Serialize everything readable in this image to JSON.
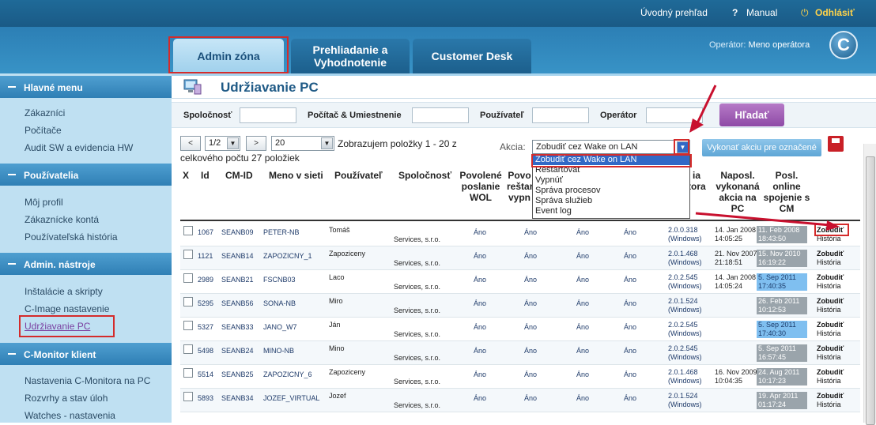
{
  "topbar": {
    "overview": "Úvodný prehľad",
    "manual": "Manual",
    "logout": "Odhlásiť"
  },
  "tabs": [
    {
      "label": "Admin zóna"
    },
    {
      "label": "Prehliadanie a Vyhodnotenie"
    },
    {
      "label": "Customer Desk"
    }
  ],
  "operator": {
    "label": "Operátor:",
    "name": "Meno operátora"
  },
  "logo": "C",
  "sidebar": {
    "sections": [
      {
        "title": "Hlavné menu",
        "items": [
          "Zákazníci",
          "Počítače",
          "Audit SW a evidencia HW"
        ]
      },
      {
        "title": "Používatelia",
        "items": [
          "Môj profil",
          "Zákaznícke kontá",
          "Používateľská história"
        ]
      },
      {
        "title": "Admin. nástroje",
        "items": [
          "Inštalácie a skripty",
          "C-Image nastavenie",
          "Udržiavanie PC"
        ]
      },
      {
        "title": "C-Monitor klient",
        "items": [
          "Nastavenia C-Monitora na PC",
          "Rozvrhy a stav úloh",
          "Watches - nastavenia"
        ]
      }
    ]
  },
  "page": {
    "title": "Udržiavanie PC"
  },
  "filters": {
    "company": "Spoločnosť",
    "computer": "Počítač & Umiestnenie",
    "user": "Používateľ",
    "operator": "Operátor",
    "search_button": "Hľadať"
  },
  "pagination": {
    "prev": "<",
    "page": "1/2",
    "next": ">",
    "per_page": "20",
    "info": "Zobrazujem položky 1 - 20 z",
    "info2": "celkového počtu 27 položiek"
  },
  "action": {
    "label": "Akcia:",
    "selected": "Zobudiť cez Wake on LAN",
    "options": [
      "Zobudiť cez Wake on LAN",
      "Reštartovať",
      "Vypnúť",
      "Správa procesov",
      "Správa služieb",
      "Event log"
    ],
    "execute_button": "Vykonať akciu pre označené"
  },
  "table": {
    "headers": {
      "x": "X",
      "id": "Id",
      "cmid": "CM-ID",
      "name": "Meno v sieti",
      "user": "Používateľ",
      "company": "Spoločnosť",
      "wol": "Povolené poslanie WOL",
      "restart": "Povo reštar vypn",
      "version": "ia tora",
      "lastaction": "Naposl. vykonaná akcia na PC",
      "online": "Posl. online spojenie s CM"
    },
    "rows": [
      {
        "id": "1067",
        "cmid": "SEANB09",
        "name": "PETER-NB",
        "user": "Tomáš",
        "company": "Services, s.r.o.",
        "wol": "Áno",
        "c2": "Áno",
        "c3": "Áno",
        "c4": "Áno",
        "ver": "2.0.0.318",
        "os": "(Windows)",
        "last": "14. Jan 2008",
        "lastt": "14:05:25",
        "on1": "11. Feb 2008",
        "on2": "18:43:50",
        "onstyle": "gray",
        "action": "Zobudiť",
        "hist": "História"
      },
      {
        "id": "1121",
        "cmid": "SEANB14",
        "name": "ZAPOZICNY_1",
        "user": "Zapoziceny",
        "company": "Services, s.r.o.",
        "wol": "Áno",
        "c2": "Áno",
        "c3": "Áno",
        "c4": "Áno",
        "ver": "2.0.1.468",
        "os": "(Windows)",
        "last": "21. Nov 2007",
        "lastt": "21:18:51",
        "on1": "15. Nov 2010",
        "on2": "16:19:22",
        "onstyle": "gray",
        "action": "Zobudiť",
        "hist": "História"
      },
      {
        "id": "2989",
        "cmid": "SEANB21",
        "name": "FSCNB03",
        "user": "Laco",
        "company": "Services, s.r.o.",
        "wol": "Áno",
        "c2": "Áno",
        "c3": "Áno",
        "c4": "Áno",
        "ver": "2.0.2.545",
        "os": "(Windows)",
        "last": "14. Jan 2008",
        "lastt": "14:05:24",
        "on1": "5. Sep 2011",
        "on2": "17:40:35",
        "onstyle": "blue",
        "action": "Zobudiť",
        "hist": "História"
      },
      {
        "id": "5295",
        "cmid": "SEANB56",
        "name": "SONA-NB",
        "user": "Miro",
        "company": "Services, s.r.o.",
        "wol": "Áno",
        "c2": "Áno",
        "c3": "Áno",
        "c4": "Áno",
        "ver": "2.0.1.524",
        "os": "(Windows)",
        "last": "",
        "lastt": "",
        "on1": "26. Feb 2011",
        "on2": "10:12:53",
        "onstyle": "gray",
        "action": "Zobudiť",
        "hist": "História"
      },
      {
        "id": "5327",
        "cmid": "SEANB33",
        "name": "JANO_W7",
        "user": "Ján",
        "company": "Services, s.r.o.",
        "wol": "Áno",
        "c2": "Áno",
        "c3": "Áno",
        "c4": "Áno",
        "ver": "2.0.2.545",
        "os": "(Windows)",
        "last": "",
        "lastt": "",
        "on1": "5. Sep 2011",
        "on2": "17:40:30",
        "onstyle": "blue",
        "action": "Zobudiť",
        "hist": "História"
      },
      {
        "id": "5498",
        "cmid": "SEANB24",
        "name": "MINO-NB",
        "user": "Mino",
        "company": "Services, s.r.o.",
        "wol": "Áno",
        "c2": "Áno",
        "c3": "Áno",
        "c4": "Áno",
        "ver": "2.0.2.545",
        "os": "(Windows)",
        "last": "",
        "lastt": "",
        "on1": "5. Sep 2011",
        "on2": "16:57:45",
        "onstyle": "gray",
        "action": "Zobudiť",
        "hist": "História"
      },
      {
        "id": "5514",
        "cmid": "SEANB25",
        "name": "ZAPOZICNY_6",
        "user": "Zapoziceny",
        "company": "Services, s.r.o.",
        "wol": "Áno",
        "c2": "Áno",
        "c3": "Áno",
        "c4": "Áno",
        "ver": "2.0.1.468",
        "os": "(Windows)",
        "last": "16. Nov 2009",
        "lastt": "10:04:35",
        "on1": "24. Aug 2011",
        "on2": "10:17:23",
        "onstyle": "gray",
        "action": "Zobudiť",
        "hist": "História"
      },
      {
        "id": "5893",
        "cmid": "SEANB34",
        "name": "JOZEF_VIRTUAL",
        "user": "Jozef",
        "company": "Services, s.r.o.",
        "wol": "Áno",
        "c2": "Áno",
        "c3": "Áno",
        "c4": "Áno",
        "ver": "2.0.1.524",
        "os": "(Windows)",
        "last": "",
        "lastt": "",
        "on1": "19. Apr 2011",
        "on2": "01:17:24",
        "onstyle": "gray",
        "action": "Zobudiť",
        "hist": "História"
      }
    ]
  },
  "colors": {
    "accent": "#2c7fb5",
    "highlight": "#d42b2b",
    "search": "#9d59b5"
  }
}
